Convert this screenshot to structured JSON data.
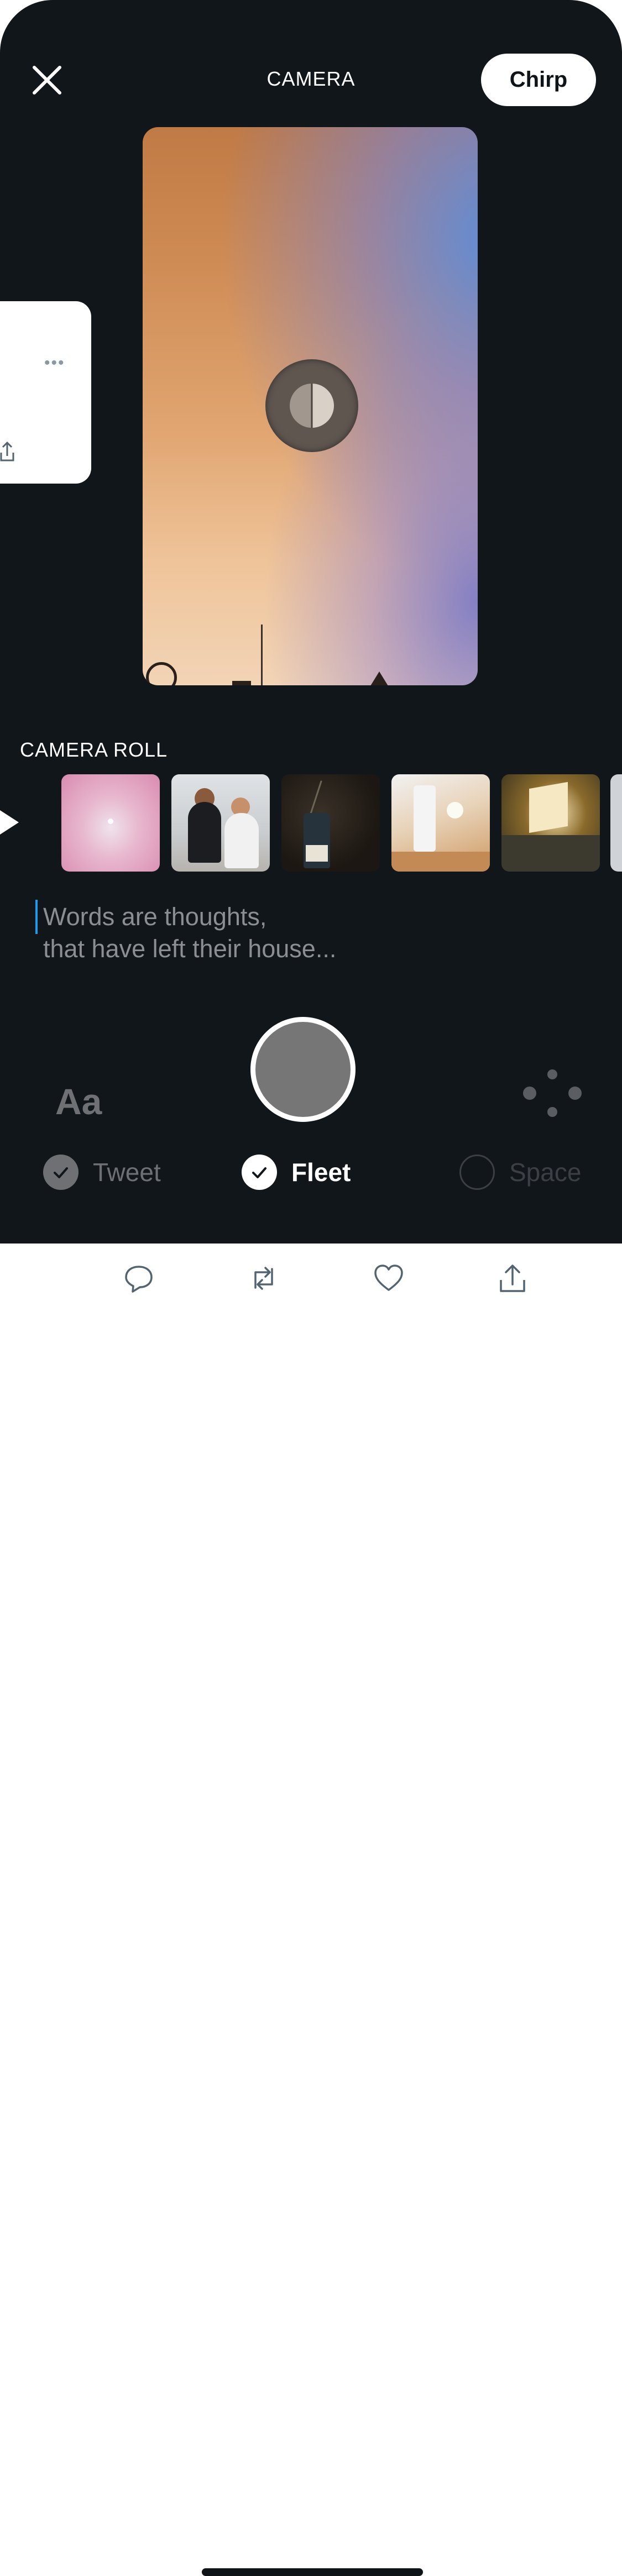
{
  "header": {
    "title": "CAMERA",
    "chirp_label": "Chirp",
    "close_icon": "close-icon"
  },
  "tweet_card": {
    "more_icon": "more-dots-icon",
    "share_icon": "share-icon"
  },
  "camera_roll": {
    "title": "CAMERA ROLL",
    "thumbnails": [
      {
        "name": "pink-sky-photo"
      },
      {
        "name": "couple-on-couch-photo"
      },
      {
        "name": "dark-bottle-photo"
      },
      {
        "name": "jar-and-flower-photo"
      },
      {
        "name": "sunlit-window-photo"
      },
      {
        "name": "partial-photo"
      }
    ]
  },
  "composer": {
    "placeholder_line1": "Words are thoughts,",
    "placeholder_line2": "that have left their house..."
  },
  "controls": {
    "text_tool_label": "Aa",
    "modes": [
      {
        "label": "Tweet",
        "selected": true
      },
      {
        "label": "Fleet",
        "selected": true
      },
      {
        "label": "Space",
        "selected": false
      }
    ]
  },
  "action_bar": {
    "icons": [
      "reply-icon",
      "retweet-icon",
      "like-icon",
      "share-icon"
    ]
  },
  "colors": {
    "background": "#11161b",
    "accent": "#1d9bf0",
    "muted": "#6e7074"
  }
}
